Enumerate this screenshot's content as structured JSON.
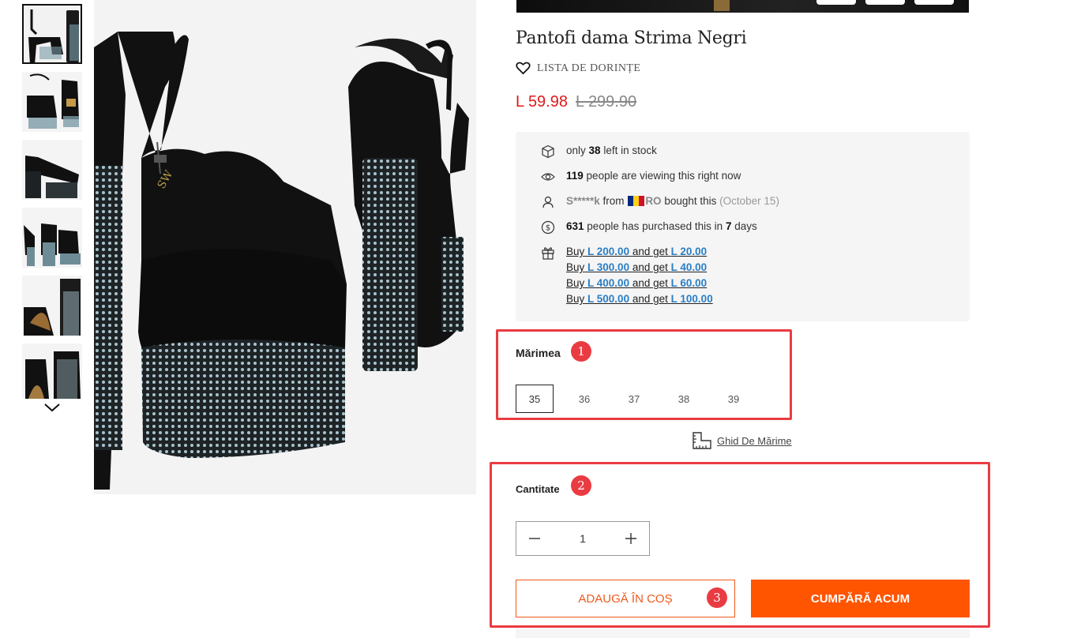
{
  "product": {
    "title": "Pantofi dama Strima Negri",
    "wishlist_label": "LISTA DE DORINȚE",
    "price_current": "L 59.98",
    "price_original": "L 299.90"
  },
  "thumbnails": {
    "count": 6,
    "active_index": 0,
    "arrow_icon": "chevron-down-icon"
  },
  "info": {
    "stock": {
      "pre": "only",
      "num": "38",
      "post": "left in stock"
    },
    "viewers": {
      "num": "119",
      "post": "people are viewing this right now"
    },
    "recent": {
      "user": "S*****k",
      "from": "from",
      "country": "RO",
      "bought": "bought this",
      "date": "(October 15)"
    },
    "purchased": {
      "num": "631",
      "mid": "people has purchased this in",
      "days": "7",
      "post": "days"
    },
    "offers": [
      {
        "buy": "Buy",
        "amount": "L 200.00",
        "get": "and get",
        "bonus": "L 20.00"
      },
      {
        "buy": "Buy",
        "amount": "L 300.00",
        "get": "and get",
        "bonus": "L 40.00"
      },
      {
        "buy": "Buy",
        "amount": "L 400.00",
        "get": "and get",
        "bonus": "L 60.00"
      },
      {
        "buy": "Buy",
        "amount": "L 500.00",
        "get": "and get",
        "bonus": "L 100.00"
      }
    ]
  },
  "size": {
    "label": "Mărimea",
    "options": [
      "35",
      "36",
      "37",
      "38",
      "39"
    ],
    "selected": "35",
    "guide_label": "Ghid De Mărime"
  },
  "quantity": {
    "label": "Cantitate",
    "value": "1"
  },
  "actions": {
    "add_to_cart": "ADAUGĂ ÎN COȘ",
    "buy_now": "CUMPĂRĂ ACUM"
  },
  "annotations": {
    "badge1": "1",
    "badge2": "2",
    "badge3": "3"
  },
  "colors": {
    "accent": "#ff5500",
    "price_red": "#e01a1a",
    "annotation_red": "#ea3b42",
    "link_blue": "#2a7ec5"
  }
}
